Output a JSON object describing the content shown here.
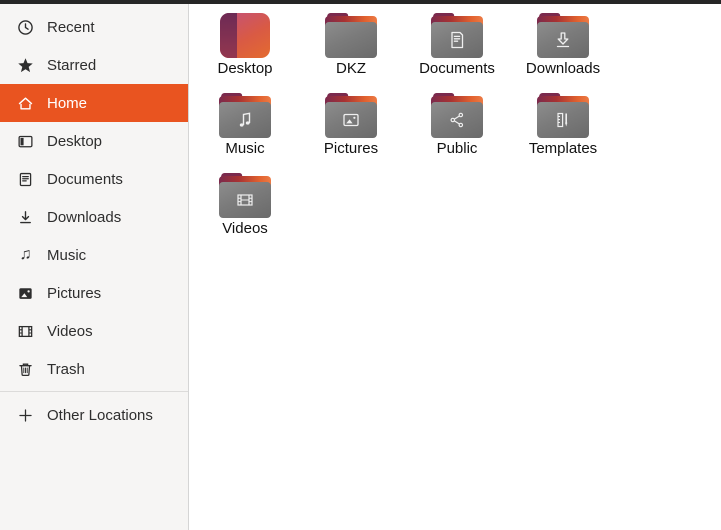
{
  "window": {
    "app": "Files",
    "top_strip_color": "#262626"
  },
  "colors": {
    "accent": "#e95420",
    "sidebar_bg": "#f6f5f4",
    "main_bg": "#ffffff",
    "folder_front": "#7b7b7b",
    "folder_back_left": "#7b2a4d",
    "folder_back_right": "#ec7b45",
    "desktop_icon_left": "#6d2a55",
    "desktop_icon_right": "#e46b2f"
  },
  "sidebar": {
    "items": [
      {
        "label": "Recent",
        "icon": "clock-icon",
        "selected": false
      },
      {
        "label": "Starred",
        "icon": "star-icon",
        "selected": false
      },
      {
        "label": "Home",
        "icon": "home-icon",
        "selected": true
      },
      {
        "label": "Desktop",
        "icon": "desktop-icon",
        "selected": false
      },
      {
        "label": "Documents",
        "icon": "document-icon",
        "selected": false
      },
      {
        "label": "Downloads",
        "icon": "download-icon",
        "selected": false
      },
      {
        "label": "Music",
        "icon": "music-note-icon",
        "selected": false
      },
      {
        "label": "Pictures",
        "icon": "picture-icon",
        "selected": false
      },
      {
        "label": "Videos",
        "icon": "film-icon",
        "selected": false
      },
      {
        "label": "Trash",
        "icon": "trash-icon",
        "selected": false
      }
    ],
    "footer_item": {
      "label": "Other Locations",
      "icon": "plus-icon"
    }
  },
  "files": {
    "items": [
      {
        "label": "Desktop",
        "icon": "desktop-gradient-icon"
      },
      {
        "label": "DKZ",
        "icon": "plain-folder-icon"
      },
      {
        "label": "Documents",
        "icon": "folder-document-emblem"
      },
      {
        "label": "Downloads",
        "icon": "folder-download-emblem"
      },
      {
        "label": "Music",
        "icon": "folder-music-emblem"
      },
      {
        "label": "Pictures",
        "icon": "folder-picture-emblem"
      },
      {
        "label": "Public",
        "icon": "folder-share-emblem"
      },
      {
        "label": "Templates",
        "icon": "folder-template-emblem"
      },
      {
        "label": "Videos",
        "icon": "folder-film-emblem"
      }
    ]
  }
}
